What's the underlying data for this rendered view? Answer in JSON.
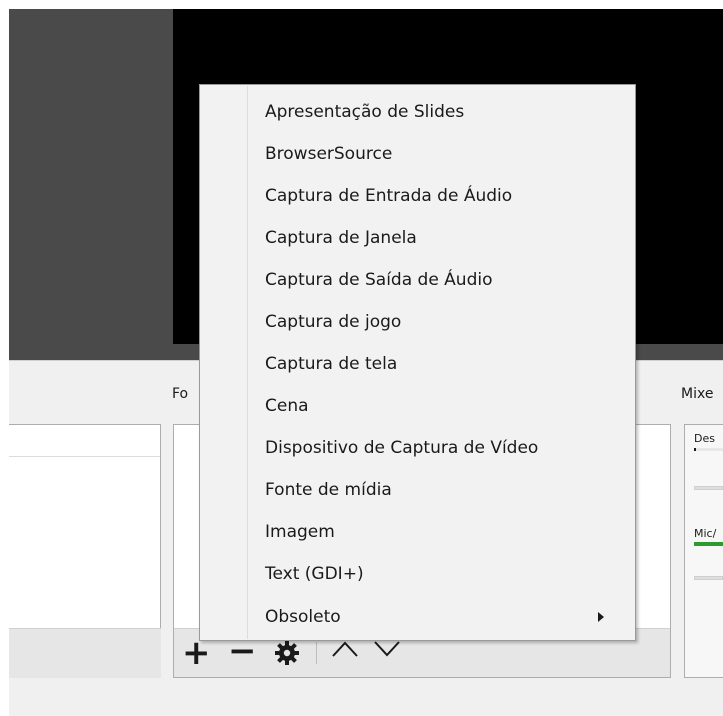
{
  "panels": {
    "sources_label": "Fo",
    "mixer_label": "Mixe",
    "mixer_channels": [
      "Des",
      "Mic/"
    ]
  },
  "context_menu": {
    "items": [
      "Apresentação de Slides",
      "BrowserSource",
      "Captura de Entrada de Áudio",
      "Captura de Janela",
      "Captura de Saída de Áudio",
      "Captura de jogo",
      "Captura de tela",
      "Cena",
      "Dispositivo de Captura de Vídeo",
      "Fonte de mídia",
      "Imagem",
      "Text (GDI+)",
      "Obsoleto"
    ]
  },
  "toolbar": {
    "add_glyph": "+",
    "remove_glyph": "−"
  },
  "colors": {
    "preview_bg": "#000000",
    "dark_panel": "#4a4a4a",
    "dock_bg": "#f0f0f0",
    "menu_bg": "#f2f2f2",
    "meter_green": "#2e9a2e"
  },
  "icons": [
    "gear-icon",
    "chevron-up-icon",
    "chevron-down-icon",
    "submenu-arrow-icon"
  ]
}
